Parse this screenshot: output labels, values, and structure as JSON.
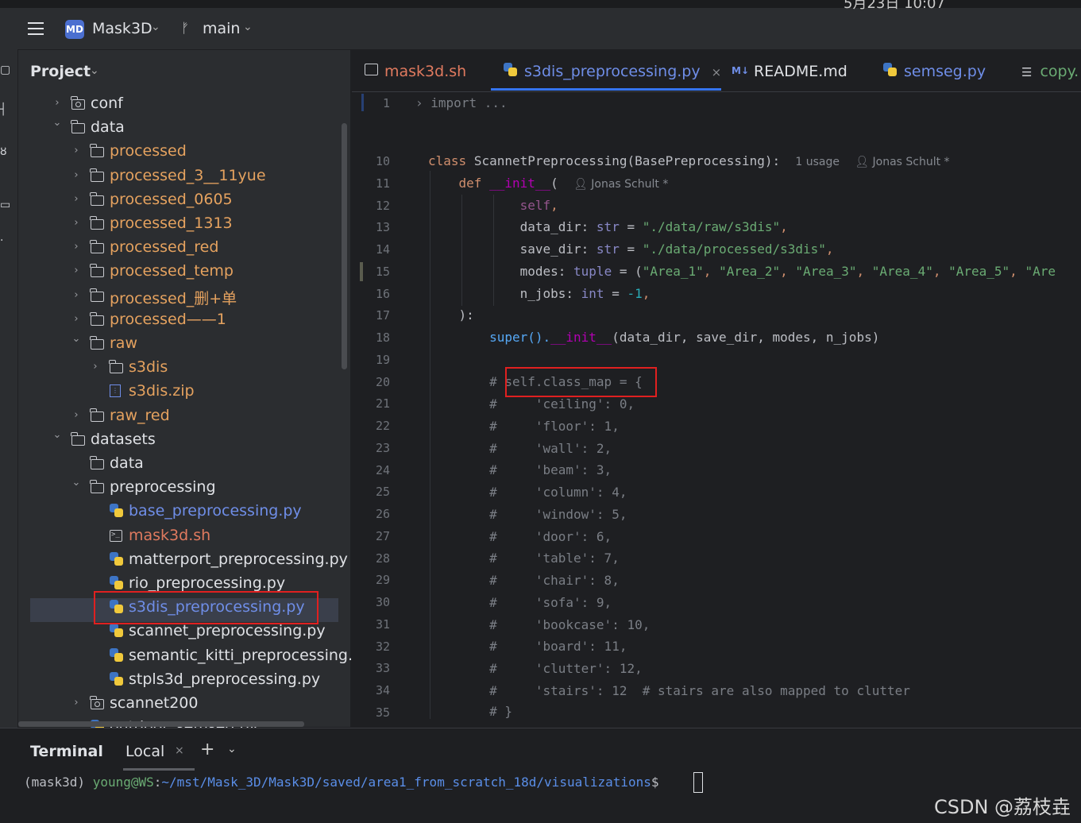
{
  "window": {
    "clock": "5月23日 10:07",
    "project_badge": "MD",
    "project_name": "Mask3D",
    "branch": "main"
  },
  "project_panel": {
    "title": "Project",
    "tree": [
      {
        "label": "conf",
        "type": "folder-module",
        "expanded": false
      },
      {
        "label": "data",
        "type": "folder",
        "expanded": true
      },
      {
        "label": "processed",
        "type": "folder",
        "expanded": false
      },
      {
        "label": "processed_3__11yue",
        "type": "folder",
        "expanded": false
      },
      {
        "label": "processed_0605",
        "type": "folder",
        "expanded": false
      },
      {
        "label": "processed_1313",
        "type": "folder",
        "expanded": false
      },
      {
        "label": "processed_red",
        "type": "folder",
        "expanded": false
      },
      {
        "label": "processed_temp",
        "type": "folder",
        "expanded": false
      },
      {
        "label": "processed_删+单",
        "type": "folder",
        "expanded": false
      },
      {
        "label": "processed——1",
        "type": "folder",
        "expanded": false
      },
      {
        "label": "raw",
        "type": "folder",
        "expanded": true
      },
      {
        "label": "s3dis",
        "type": "folder",
        "expanded": false
      },
      {
        "label": "s3dis.zip",
        "type": "zip"
      },
      {
        "label": "raw_red",
        "type": "folder",
        "expanded": false
      },
      {
        "label": "datasets",
        "type": "folder",
        "expanded": true
      },
      {
        "label": "data",
        "type": "folder"
      },
      {
        "label": "preprocessing",
        "type": "folder",
        "expanded": true
      },
      {
        "label": "base_preprocessing.py",
        "type": "python"
      },
      {
        "label": "mask3d.sh",
        "type": "shell"
      },
      {
        "label": "matterport_preprocessing.py",
        "type": "python"
      },
      {
        "label": "rio_preprocessing.py",
        "type": "python"
      },
      {
        "label": "s3dis_preprocessing.py",
        "type": "python",
        "selected": true
      },
      {
        "label": "scannet_preprocessing.py",
        "type": "python"
      },
      {
        "label": "semantic_kitti_preprocessing.py",
        "type": "python"
      },
      {
        "label": "stpls3d_preprocessing.py",
        "type": "python"
      },
      {
        "label": "scannet200",
        "type": "folder-module",
        "expanded": false
      },
      {
        "label": "outdoor_semseg.py",
        "type": "python"
      }
    ]
  },
  "tabs": [
    {
      "label": "mask3d.sh",
      "icon": "terminal-icon"
    },
    {
      "label": "s3dis_preprocessing.py",
      "icon": "python-icon",
      "active": true,
      "close": "×"
    },
    {
      "label": "README.md",
      "icon": "markdown-icon",
      "icon_text": "M↓"
    },
    {
      "label": "semseg.py",
      "icon": "python-icon"
    },
    {
      "label": "copy.",
      "icon": "text-file-icon"
    }
  ],
  "editor": {
    "line_numbers": [
      "1",
      "10",
      "11",
      "12",
      "13",
      "14",
      "15",
      "16",
      "17",
      "18",
      "19",
      "20",
      "21",
      "22",
      "23",
      "24",
      "25",
      "26",
      "27",
      "28",
      "29",
      "30",
      "31",
      "32",
      "33",
      "34",
      "35"
    ],
    "fold_import": "import ...",
    "class_kw": "class",
    "class_name": "ScannetPreprocessing",
    "class_base": "(BasePreprocessing):",
    "usage_hint": "1 usage",
    "author_hint": "Jonas Schult *",
    "def_kw": "def",
    "init_name": "__init__",
    "init_paren": "(",
    "self_param": "self",
    "data_dir_name": "data_dir: ",
    "data_dir_type": "str",
    "data_dir_value": "\"./data/raw/s3dis\"",
    "save_dir_name": "save_dir: ",
    "save_dir_type": "str",
    "save_dir_value": "\"./data/processed/s3dis\"",
    "modes_name": "modes: ",
    "modes_type": "tuple",
    "modes_areas": [
      "\"Area_1\"",
      "\"Area_2\"",
      "\"Area_3\"",
      "\"Area_4\"",
      "\"Area_5\"",
      "\"Are"
    ],
    "n_jobs_name": "n_jobs: ",
    "n_jobs_type": "int",
    "n_jobs_value": "-1",
    "close_paren": "):",
    "super_call": "super().",
    "super_init": "__init__",
    "super_args": "(data_dir, save_dir, modes, n_jobs)",
    "class_map_open": "self.class_map = {",
    "class_map_entries": [
      "'ceiling': 0,",
      "'floor': 1,",
      "'wall': 2,",
      "'beam': 3,",
      "'column': 4,",
      "'window': 5,",
      "'door': 6,",
      "'table': 7,",
      "'chair': 8,",
      "'sofa': 9,",
      "'bookcase': 10,",
      "'board': 11,",
      "'clutter': 12,",
      "'stairs': 12  # stairs are also mapped to clutter"
    ],
    "class_map_close": "# }"
  },
  "terminal": {
    "title": "Terminal",
    "tab": "Local",
    "env": "(mask3d) ",
    "user_host": "young@WS",
    "colon": ":",
    "path": "~/mst/Mask_3D/Mask3D/saved/area1_from_scratch_18d/visualizations",
    "dollar": "$ "
  },
  "watermark": "CSDN @荔枝垚",
  "colors": {
    "accent": "#3574f0",
    "highlight_box": "#e02020",
    "python_file": "#6f8ee8",
    "shell_file": "#e07a5f",
    "modified_folder": "#e5a25f"
  }
}
